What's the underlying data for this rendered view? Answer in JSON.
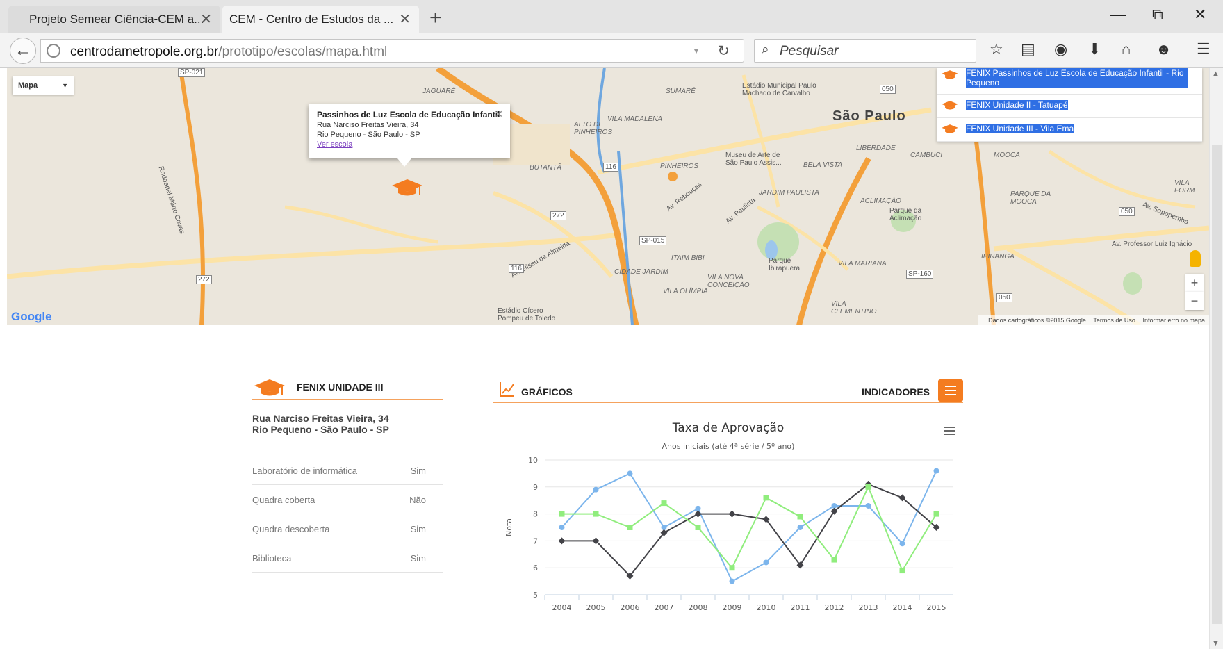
{
  "browser": {
    "tabs": [
      {
        "title": "Projeto Semear Ciência-CEM a...",
        "close": "✕"
      },
      {
        "title": "CEM - Centro de Estudos da ...",
        "close": "✕"
      }
    ],
    "new_tab": "+",
    "url_host": "centrodametropole.org.br",
    "url_path": "/prototipo/escolas/mapa.html",
    "search_placeholder": "Pesquisar",
    "window_minimize": "—",
    "window_restore": "⧉",
    "window_close": "✕"
  },
  "map": {
    "type_selector": "Mapa",
    "city_label": "São Paulo",
    "labels": [
      "Estádio Municipal Paulo Machado de Carvalho",
      "Museu de Arte de São Paulo Assis...",
      "Parque Ibirapuera",
      "Parque da Aclimação",
      "Estádio Cícero Pompeu de Toledo",
      "PINHEIROS",
      "BUTANTÃ",
      "JARDIM PAULISTA",
      "BELA VISTA",
      "LIBERDADE",
      "CAMBUCI",
      "MOOCA",
      "VILA MADALENA",
      "ALTO DE PINHEIROS",
      "SUMARÉ",
      "JAGUARÉ",
      "CIDADE JARDIM",
      "ITAIM BIBI",
      "VILA OLÍMPIA",
      "VILA NOVA CONCEIÇÃO",
      "VILA MARIANA",
      "IPIRANGA",
      "VILA CLEMENTINO",
      "ACLIMAÇÃO",
      "PARQUE DA MOOCA",
      "Av. Professor Luiz Ignácio",
      "Rodoanel Mário Covas",
      "Av. Eliseu de Almeida",
      "Av. Rebouças",
      "Av. Paulista",
      "Av. Sapopemba",
      "VILA FORM"
    ],
    "info_window": {
      "title": "Passinhos de Luz Escola de Educação Infantil",
      "address_line1": "Rua Narciso Freitas Vieira, 34",
      "address_line2": "Rio Pequeno - São Paulo - SP",
      "link": "Ver escola",
      "close": "✕"
    },
    "school_list": [
      "FENIX Passinhos de Luz Escola de Educação Infantil - Rio Pequeno",
      "FENIX Unidade II - Tatuapé",
      "FENIX Unidade III - Vila Ema"
    ],
    "zoom_in": "+",
    "zoom_out": "−",
    "google_logo": "Google",
    "footer": {
      "data": "Dados cartográficos ©2015 Google",
      "terms": "Termos de Uso",
      "report": "Informar erro no mapa"
    },
    "road_shields": [
      "SP-021",
      "050",
      "116",
      "272",
      "SP-015",
      "116",
      "272",
      "SP-160",
      "050",
      "050"
    ]
  },
  "school": {
    "name": "FENIX UNIDADE III",
    "address_line1": "Rua Narciso Freitas Vieira, 34",
    "address_line2": "Rio Pequeno - São Paulo - SP",
    "features": [
      {
        "label": "Laboratório de informática",
        "value": "Sim"
      },
      {
        "label": "Quadra coberta",
        "value": "Não"
      },
      {
        "label": "Quadra descoberta",
        "value": "Sim"
      },
      {
        "label": "Biblioteca",
        "value": "Sim"
      }
    ]
  },
  "charts_panel": {
    "title": "GRÁFICOS",
    "indicators": "INDICADORES"
  },
  "colors": {
    "accent": "#f47c20",
    "accent_line": "#f5a25d",
    "series_blue": "#7cb5ec",
    "series_black": "#434348",
    "series_green": "#90ed7d",
    "map_road": "#f7c75d",
    "map_highway": "#f3a03b",
    "selection": "#2f6fe4"
  },
  "chart_data": {
    "type": "line",
    "title": "Taxa de Aprovação",
    "subtitle": "Anos iniciais (até 4ª série / 5º ano)",
    "ylabel": "Nota",
    "xlabel": "",
    "ylim": [
      5,
      10
    ],
    "yticks": [
      5,
      6,
      7,
      8,
      9,
      10
    ],
    "categories": [
      "2004",
      "2005",
      "2006",
      "2007",
      "2008",
      "2009",
      "2010",
      "2011",
      "2012",
      "2013",
      "2014",
      "2015"
    ],
    "grid": true,
    "series": [
      {
        "color": "#7cb5ec",
        "marker": "circle",
        "values": [
          7.5,
          8.9,
          9.5,
          7.5,
          8.2,
          5.5,
          6.2,
          7.5,
          8.3,
          8.3,
          6.9,
          9.6
        ]
      },
      {
        "color": "#434348",
        "marker": "diamond",
        "values": [
          7.0,
          7.0,
          5.7,
          7.3,
          8.0,
          8.0,
          7.8,
          6.1,
          8.1,
          9.1,
          8.6,
          7.5
        ]
      },
      {
        "color": "#90ed7d",
        "marker": "square",
        "values": [
          8.0,
          8.0,
          7.5,
          8.4,
          7.5,
          6.0,
          8.6,
          7.9,
          6.3,
          9.0,
          5.9,
          8.0
        ]
      }
    ]
  }
}
